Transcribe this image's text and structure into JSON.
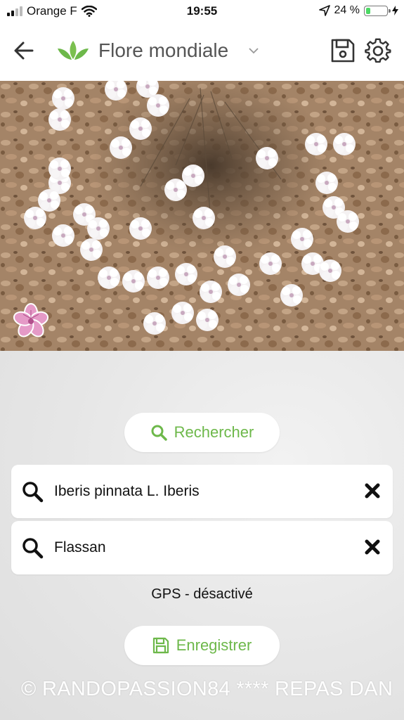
{
  "status_bar": {
    "carrier": "Orange F",
    "time": "19:55",
    "battery_text": "24 %",
    "battery_level": 0.24
  },
  "nav": {
    "title": "Flore mondiale"
  },
  "actions": {
    "search_label": "Rechercher",
    "save_label": "Enregistrer"
  },
  "fields": {
    "species": "Iberis pinnata L. Iberis",
    "location": "Flassan"
  },
  "gps_status": "GPS - désactivé",
  "watermark": "© RANDOPASSION84 ****   REPAS DAN",
  "colors": {
    "accent": "#6db84a",
    "flower_badge": "#e59ac7"
  },
  "icons": [
    "back-arrow-icon",
    "leaf-logo-icon",
    "chevron-down-icon",
    "save-icon",
    "gear-icon",
    "flower-icon",
    "search-icon",
    "close-icon"
  ]
}
